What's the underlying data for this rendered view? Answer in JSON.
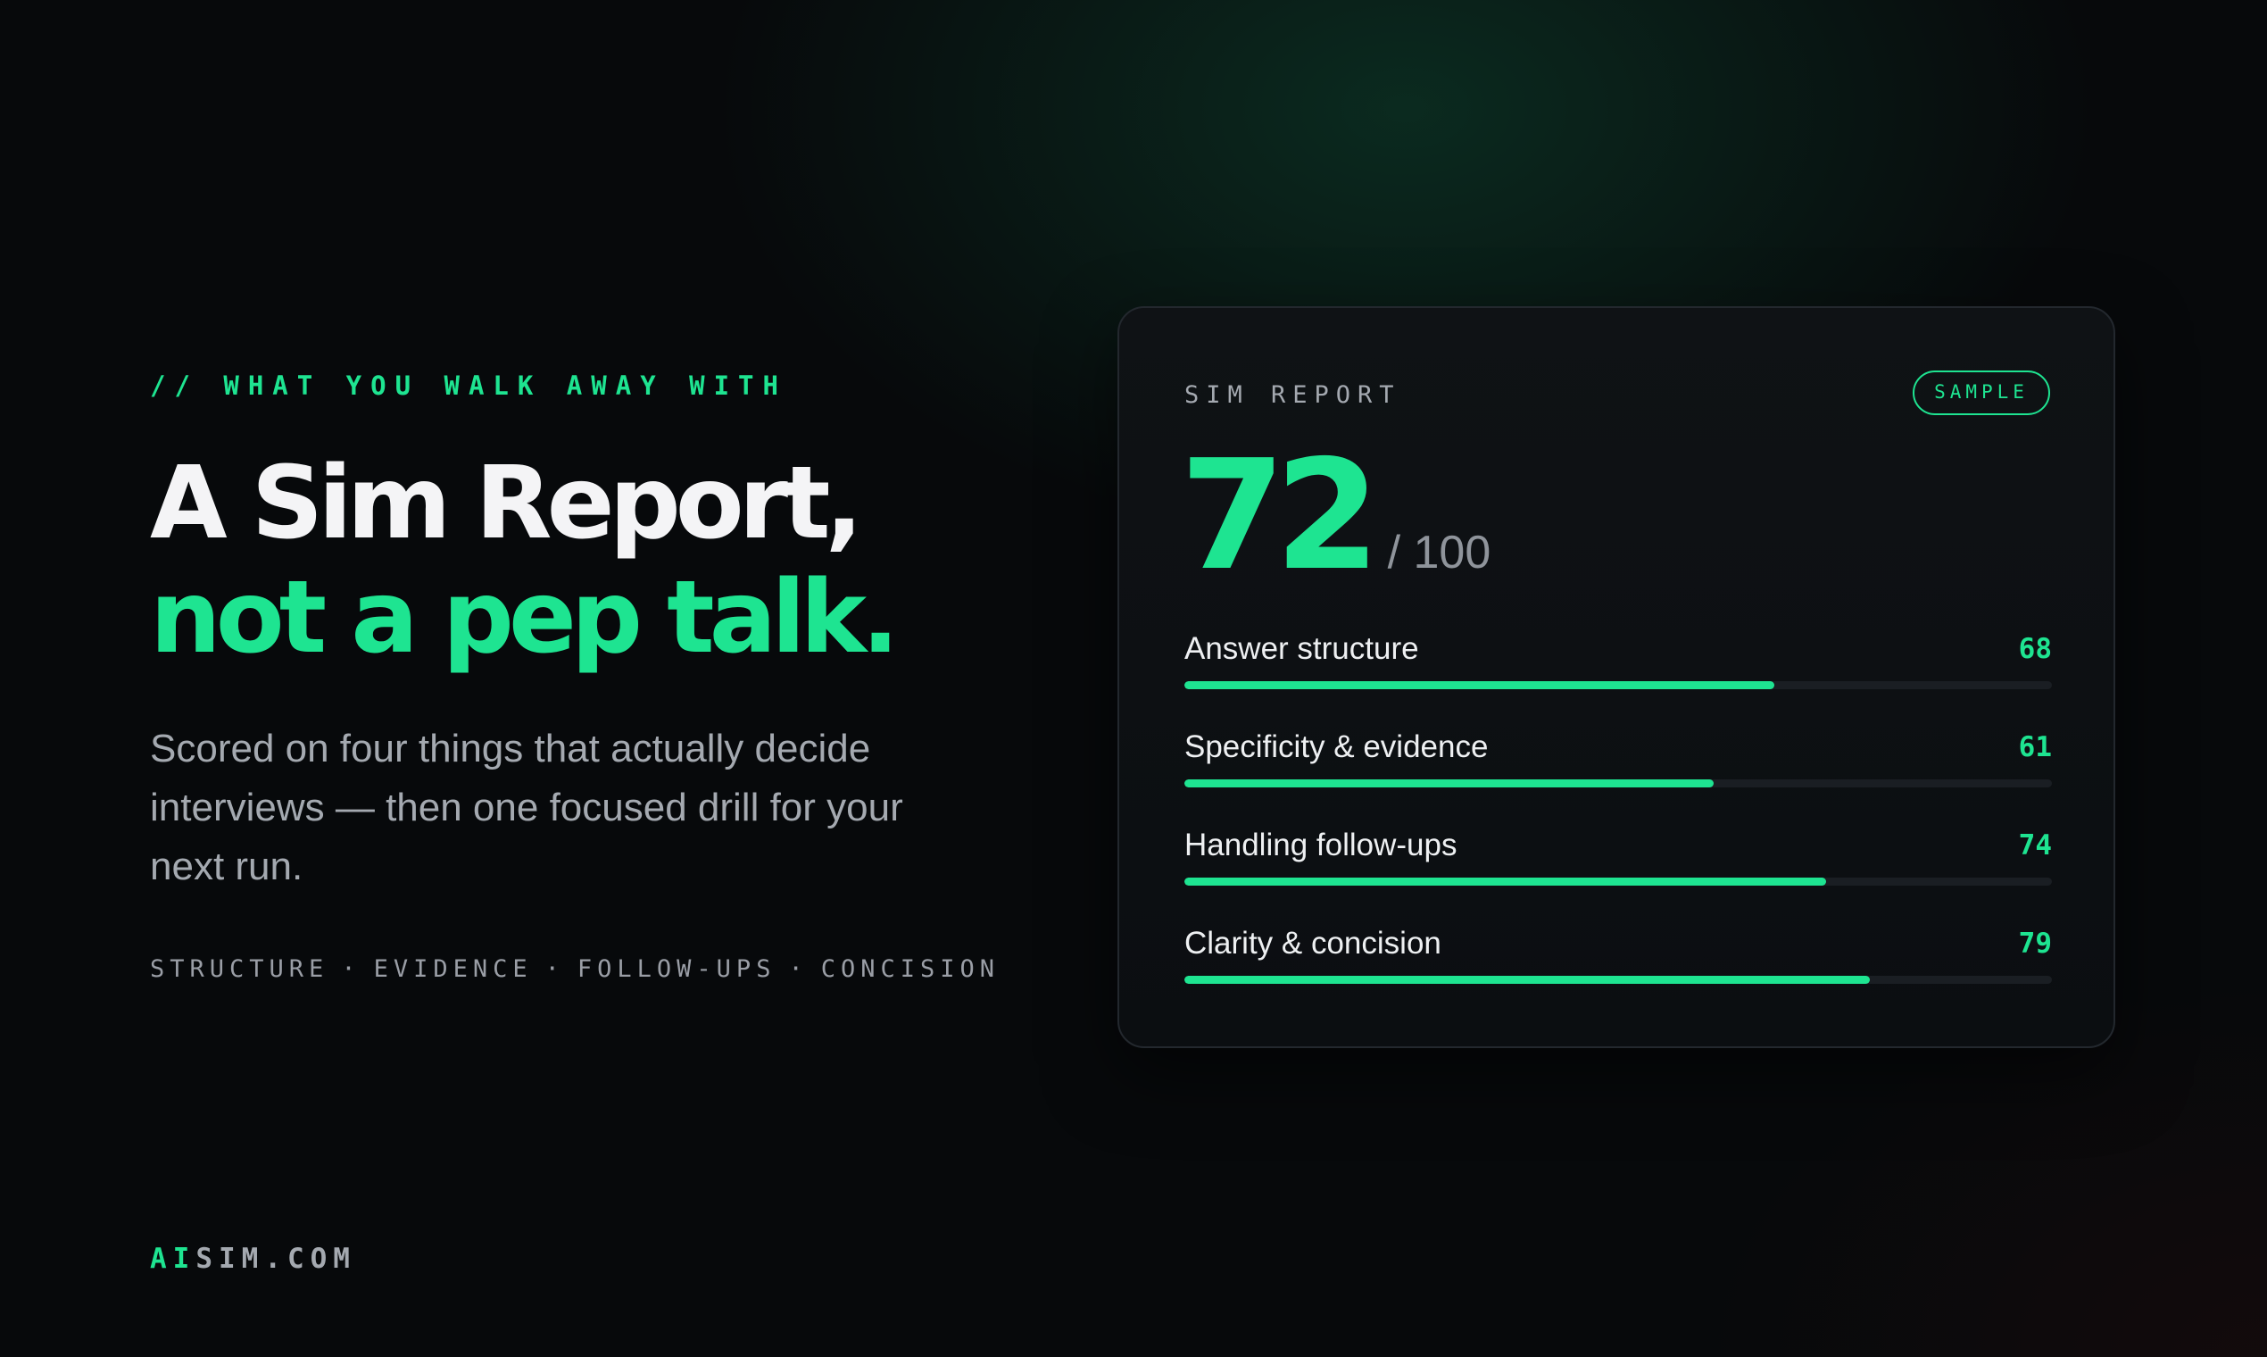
{
  "eyebrow": "// WHAT YOU WALK AWAY WITH",
  "headline": {
    "line1": "A Sim Report,",
    "line2": "not a pep talk."
  },
  "subtitle": "Scored on four things that actually decide interviews — then one focused drill for your next run.",
  "tags": [
    "STRUCTURE",
    "EVIDENCE",
    "FOLLOW-UPS",
    "CONCISION"
  ],
  "tag_separator": "·",
  "brand": {
    "part1": "AI",
    "part2": "SIM.COM"
  },
  "report": {
    "title": "SIM REPORT",
    "badge": "SAMPLE",
    "score": "72",
    "score_suffix": "/ 100",
    "metrics": [
      {
        "label": "Answer structure",
        "value": 68
      },
      {
        "label": "Specificity & evidence",
        "value": 61
      },
      {
        "label": "Handling follow-ups",
        "value": 74
      },
      {
        "label": "Clarity & concision",
        "value": 79
      }
    ]
  },
  "colors": {
    "accent": "#1ee491",
    "background": "#07090b",
    "card": "#0f1215",
    "track": "#1a1e23"
  }
}
